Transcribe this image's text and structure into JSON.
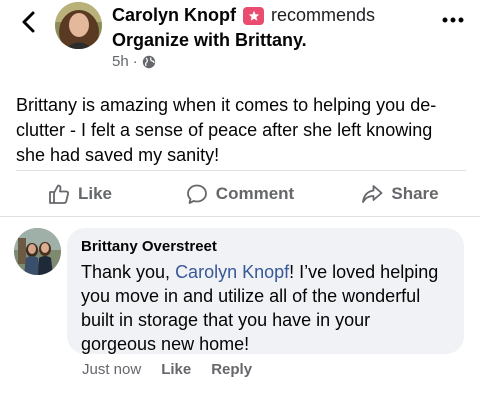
{
  "header": {
    "author_name": "Carolyn Knopf",
    "verb": "recommends",
    "page_name": "Organize with Brittany.",
    "time": "5h",
    "separator": "·"
  },
  "post": {
    "text": "Brittany is amazing when it comes to helping you de-clutter - I felt a sense of peace after she left knowing she had saved my sanity!"
  },
  "actions": {
    "like": "Like",
    "comment": "Comment",
    "share": "Share"
  },
  "comment": {
    "author": "Brittany Overstreet",
    "text_before": "Thank you, ",
    "mention": "Carolyn Knopf",
    "text_after": "! I’ve loved helping you move in and utilize all of the wonderful built in storage that you have in your gorgeous new home!",
    "time": "Just now",
    "like_label": "Like",
    "reply_label": "Reply"
  },
  "colors": {
    "recommend_badge": "#e94c6e",
    "link": "#385898",
    "muted": "#65676b",
    "bubble": "#f0f2f5"
  },
  "icons": [
    "back-arrow-icon",
    "recommend-badge-icon",
    "globe-icon",
    "more-dots-icon",
    "thumbs-up-icon",
    "comment-icon",
    "share-icon"
  ]
}
